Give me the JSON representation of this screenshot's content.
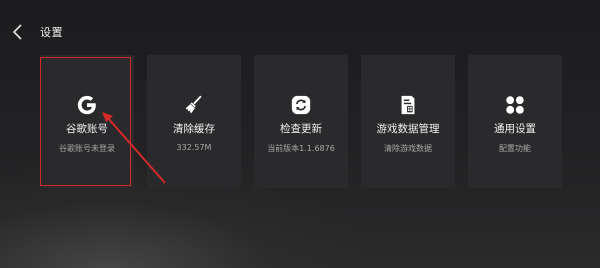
{
  "header": {
    "title": "设置"
  },
  "cards": [
    {
      "label": "谷歌账号",
      "sub": "谷歌账号未登录",
      "icon": "google-g-icon"
    },
    {
      "label": "清除缓存",
      "sub": "332.57M",
      "icon": "broom-icon"
    },
    {
      "label": "检查更新",
      "sub": "当前版本1.1.6876",
      "icon": "refresh-icon"
    },
    {
      "label": "游戏数据管理",
      "sub": "清除游戏数据",
      "icon": "document-grid-icon"
    },
    {
      "label": "通用设置",
      "sub": "配置功能",
      "icon": "four-petal-icon"
    }
  ],
  "colors": {
    "card_background": "#2a2a2d",
    "highlight_border": "#d42a2a"
  }
}
